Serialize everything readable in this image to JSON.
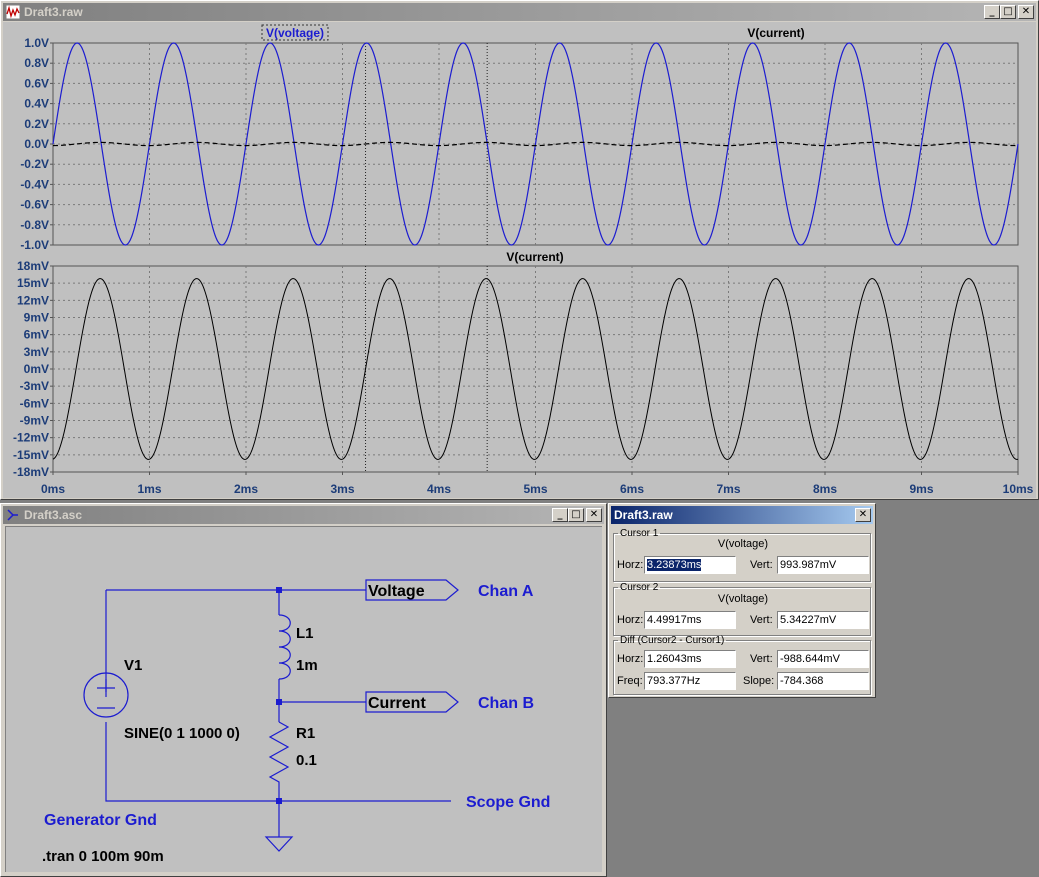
{
  "plot_window": {
    "title": "Draft3.raw",
    "top_pane": {
      "trace_labels": [
        "V(voltage)",
        "V(current)"
      ],
      "y_ticks": [
        "1.0V",
        "0.8V",
        "0.6V",
        "0.4V",
        "0.2V",
        "0.0V",
        "-0.2V",
        "-0.4V",
        "-0.6V",
        "-0.8V",
        "-1.0V"
      ]
    },
    "bottom_pane": {
      "trace_label": "V(current)",
      "y_ticks": [
        "18mV",
        "15mV",
        "12mV",
        "9mV",
        "6mV",
        "3mV",
        "0mV",
        "-3mV",
        "-6mV",
        "-9mV",
        "-12mV",
        "-15mV",
        "-18mV"
      ]
    },
    "x_ticks": [
      "0ms",
      "1ms",
      "2ms",
      "3ms",
      "4ms",
      "5ms",
      "6ms",
      "7ms",
      "8ms",
      "9ms",
      "10ms"
    ],
    "colors": {
      "voltage_trace": "#1c1cd0",
      "current_trace": "#000000",
      "background": "#c0c0c0"
    }
  },
  "chart_data": [
    {
      "type": "line",
      "title": "",
      "xlabel": "",
      "ylabel": "",
      "xlim": [
        0,
        10
      ],
      "ylim": [
        -1.0,
        1.0
      ],
      "grid": true,
      "series": [
        {
          "name": "V(voltage)",
          "function": "1.0*sin(2*pi*1000*t)",
          "frequency_hz": 1000,
          "amplitude": 1.0,
          "unit": "V"
        },
        {
          "name": "V(current)",
          "function": "0.0158*sin(2*pi*1000*t - 1.5)",
          "frequency_hz": 1000,
          "amplitude": 0.0158,
          "unit": "V"
        }
      ],
      "cursors_ms": [
        3.23873,
        4.49917
      ]
    },
    {
      "type": "line",
      "title": "",
      "xlabel": "",
      "ylabel": "",
      "xlim": [
        0,
        10
      ],
      "ylim": [
        -18,
        18
      ],
      "grid": true,
      "series": [
        {
          "name": "V(current)",
          "frequency_hz": 1000,
          "amplitude": 15.8,
          "unit": "mV"
        }
      ]
    }
  ],
  "schematic_window": {
    "title": "Draft3.asc",
    "components": {
      "source_name": "V1",
      "source_value": "SINE(0 1 1000 0)",
      "inductor_name": "L1",
      "inductor_value": "1m",
      "resistor_name": "R1",
      "resistor_value": "0.1"
    },
    "labels": {
      "voltage_net": "Voltage",
      "current_net": "Current",
      "chan_a": "Chan A",
      "chan_b": "Chan B",
      "scope_gnd": "Scope Gnd",
      "generator_gnd": "Generator Gnd",
      "directive": ".tran 0 100m 90m"
    }
  },
  "cursor_window": {
    "title": "Draft3.raw",
    "cursor1": {
      "group": "Cursor 1",
      "trace": "V(voltage)",
      "horz_label": "Horz:",
      "horz": "3.23873ms",
      "vert_label": "Vert:",
      "vert": "993.987mV"
    },
    "cursor2": {
      "group": "Cursor 2",
      "trace": "V(voltage)",
      "horz_label": "Horz:",
      "horz": "4.49917ms",
      "vert_label": "Vert:",
      "vert": "5.34227mV"
    },
    "diff": {
      "group": "Diff (Cursor2 - Cursor1)",
      "horz_label": "Horz:",
      "horz": "1.26043ms",
      "vert_label": "Vert:",
      "vert": "-988.644mV",
      "freq_label": "Freq:",
      "freq": "793.377Hz",
      "slope_label": "Slope:",
      "slope": "-784.368"
    }
  }
}
